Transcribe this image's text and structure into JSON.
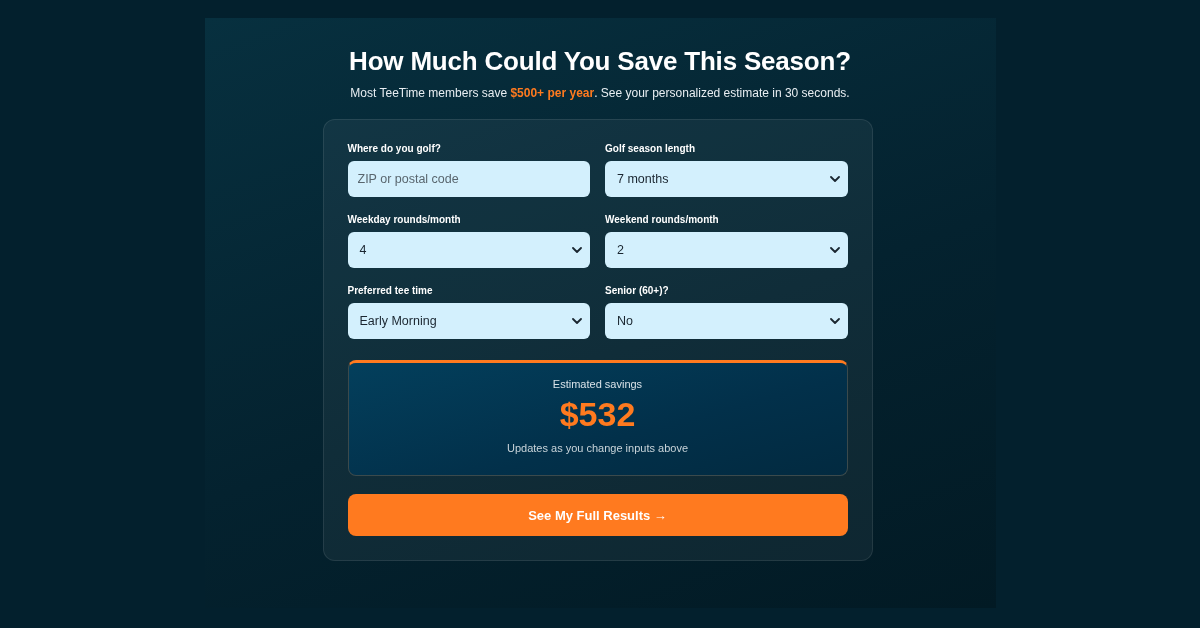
{
  "heading": {
    "title": "How Much Could You Save This Season?",
    "subtitle": "Most TeeTime members save **$500+ per year**. See your personalized estimate in 30 seconds."
  },
  "form": {
    "fields": [
      {
        "kind": "input",
        "label": "Where do you golf?",
        "placeholder": "ZIP or postal code"
      },
      {
        "kind": "select",
        "label": "Golf season length",
        "value": "7 months"
      },
      {
        "kind": "select",
        "label": "Weekday rounds/month",
        "value": "4"
      },
      {
        "kind": "select",
        "label": "Weekend rounds/month",
        "value": "2"
      },
      {
        "kind": "select",
        "label": "Preferred tee time",
        "value": "Early Morning"
      },
      {
        "kind": "select",
        "label": "Senior (60+)?",
        "value": "No"
      }
    ]
  },
  "result": {
    "label": "Estimated savings",
    "amount": "$532",
    "note": "Updates as you change inputs above"
  },
  "button": {
    "label": "See My Full Results →"
  }
}
